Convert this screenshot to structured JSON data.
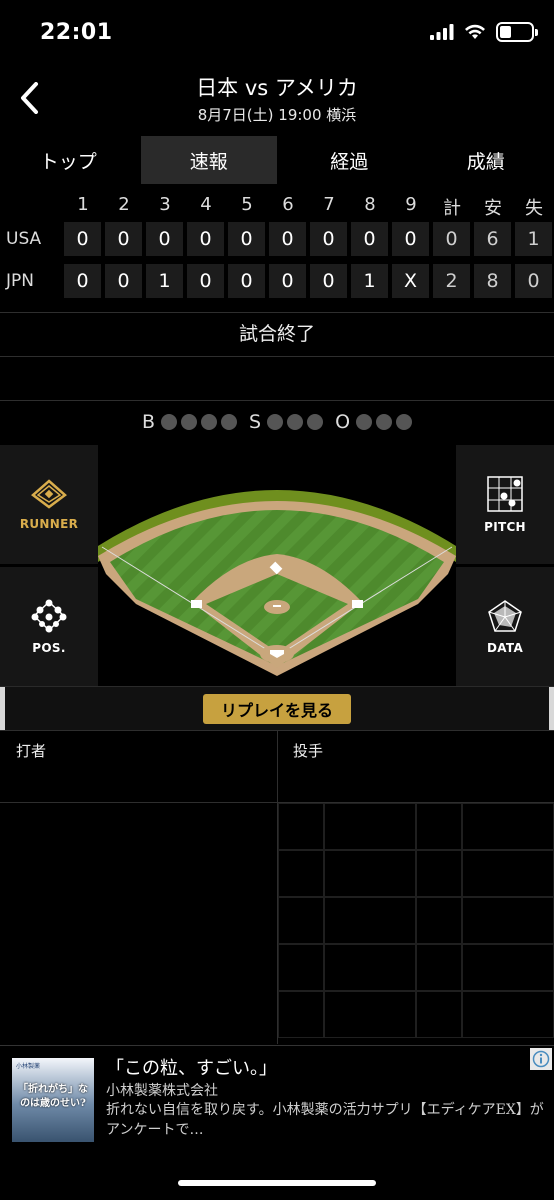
{
  "status_bar": {
    "time": "22:01",
    "battery_level": 0.35
  },
  "header": {
    "title": "日本 vs アメリカ",
    "subtitle": "8月7日(土) 19:00 横浜"
  },
  "tabs": [
    {
      "label": "トップ",
      "active": false
    },
    {
      "label": "速報",
      "active": true
    },
    {
      "label": "経過",
      "active": false
    },
    {
      "label": "成績",
      "active": false
    }
  ],
  "scoreboard": {
    "columns": [
      "1",
      "2",
      "3",
      "4",
      "5",
      "6",
      "7",
      "8",
      "9",
      "計",
      "安",
      "失"
    ],
    "rows": [
      {
        "team": "USA",
        "cells": [
          "0",
          "0",
          "0",
          "0",
          "0",
          "0",
          "0",
          "0",
          "0",
          "0",
          "6",
          "1"
        ]
      },
      {
        "team": "JPN",
        "cells": [
          "0",
          "0",
          "1",
          "0",
          "0",
          "0",
          "0",
          "1",
          "X",
          "2",
          "8",
          "0"
        ]
      }
    ]
  },
  "game_status": "試合終了",
  "count": {
    "balls": {
      "label": "B",
      "max": 4,
      "value": 0
    },
    "strikes": {
      "label": "S",
      "max": 3,
      "value": 0
    },
    "outs": {
      "label": "O",
      "max": 3,
      "value": 0
    }
  },
  "side_buttons": {
    "runner": "RUNNER",
    "pitch": "PITCH",
    "positions": "POS.",
    "data": "DATA"
  },
  "replay_button": "リプレイを見る",
  "batter_label": "打者",
  "pitcher_label": "投手",
  "ad": {
    "thumb_brand": "小林製薬",
    "thumb_text": "「折れがち」なのは歳のせい?",
    "headline": "「この粒、すごい。」",
    "advertiser": "小林製薬株式会社",
    "description": "折れない自信を取り戻す。小林製薬の活力サプリ【エディケアEX】がアンケートで…"
  },
  "colors": {
    "accent_gold": "#d9ad4c",
    "replay_button": "#c7a13f",
    "field_grass": "#4f8a2e",
    "field_dirt": "#c9a77c"
  }
}
